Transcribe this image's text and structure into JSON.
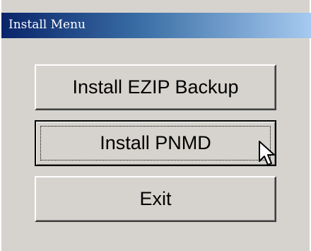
{
  "window": {
    "title": "Install Menu"
  },
  "buttons": {
    "install_ezip": "Install EZIP Backup",
    "install_pnmd": "Install PNMD",
    "exit": "Exit"
  },
  "icons": {
    "cursor": "arrow-cursor-icon"
  },
  "colors": {
    "face": "#d6d3ce",
    "title_start": "#0a246a",
    "title_end": "#a6caf0"
  }
}
